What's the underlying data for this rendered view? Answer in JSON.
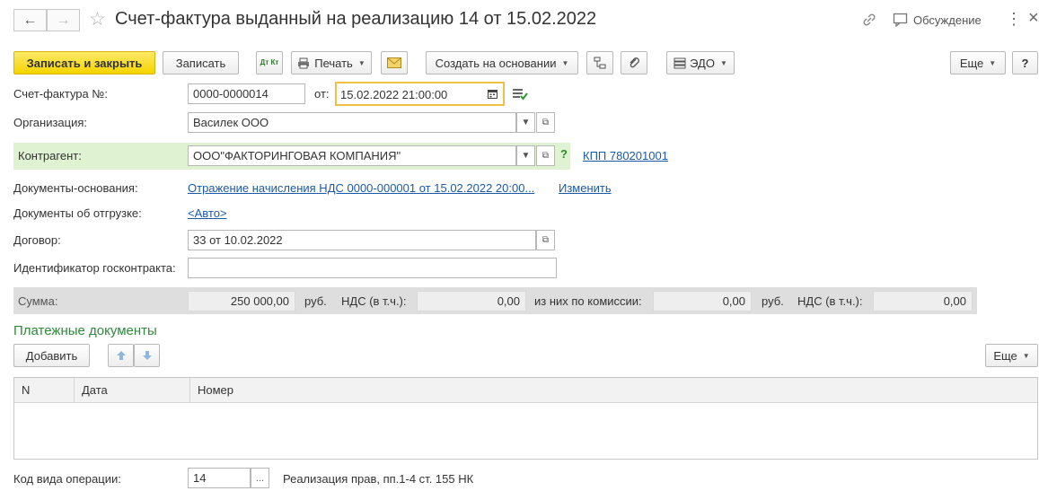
{
  "header": {
    "title": "Счет-фактура выданный на реализацию 14 от 15.02.2022",
    "discussion": "Обсуждение",
    "nav_back": "←",
    "nav_forward": "→",
    "star": "☆",
    "link_icon": "🔗",
    "menu_dots": "⋮",
    "close": "×"
  },
  "toolbar": {
    "save_close": "Записать и закрыть",
    "save": "Записать",
    "dtkt": "Дт Кт",
    "print": "Печать",
    "create_based": "Создать на основании",
    "edo": "ЭДО",
    "more": "Еще",
    "help": "?"
  },
  "form": {
    "invoice_label": "Счет-фактура №:",
    "invoice_number": "0000-0000014",
    "from_label": "от:",
    "date": "15.02.2022 21:00:00",
    "org_label": "Организация:",
    "org_value": "Василек ООО",
    "counterparty_label": "Контрагент:",
    "counterparty_value": "ООО\"ФАКТОРИНГОВАЯ КОМПАНИЯ\"",
    "question": "?",
    "kpp_link": "КПП 780201001",
    "base_docs_label": "Документы-основания:",
    "base_docs_link": "Отражение начисления НДС 0000-000001 от 15.02.2022 20:00...",
    "change_link": "Изменить",
    "shipment_label": "Документы об отгрузке:",
    "shipment_link": "<Авто>",
    "contract_label": "Договор:",
    "contract_value": "33 от 10.02.2022",
    "gov_contract_label": "Идентификатор госконтракта:",
    "gov_contract_value": ""
  },
  "sum": {
    "label": "Сумма:",
    "amount": "250 000,00",
    "currency1": "руб.",
    "vat_label1": "НДС (в т.ч.):",
    "vat1": "0,00",
    "commission_label": "из них по комиссии:",
    "commission": "0,00",
    "currency2": "руб.",
    "vat_label2": "НДС (в т.ч.):",
    "vat2": "0,00"
  },
  "payments": {
    "title": "Платежные документы",
    "add": "Добавить",
    "more": "Еще",
    "columns": [
      "N",
      "Дата",
      "Номер"
    ]
  },
  "operation": {
    "label": "Код вида операции:",
    "code": "14",
    "dots": "...",
    "description": "Реализация прав, пп.1-4 ст. 155 НК"
  }
}
